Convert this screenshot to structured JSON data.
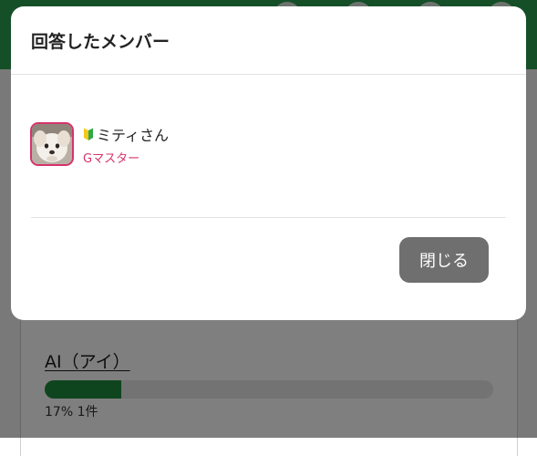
{
  "colors": {
    "header_green": "#2b9e50",
    "progress_green": "#1c8a3e",
    "rank_pink": "#d6336c",
    "close_button_bg": "#6f6f6f"
  },
  "modal": {
    "title": "回答したメンバー",
    "members": [
      {
        "avatar": "dog-photo-avatar",
        "badge_icon": "beginner-mark-icon",
        "name": "ミティさん",
        "rank": "Gマスター"
      }
    ],
    "close_label": "閉じる"
  },
  "background": {
    "option": {
      "label": "AI（アイ）",
      "percent": 17,
      "stat": "17% 1件"
    }
  }
}
